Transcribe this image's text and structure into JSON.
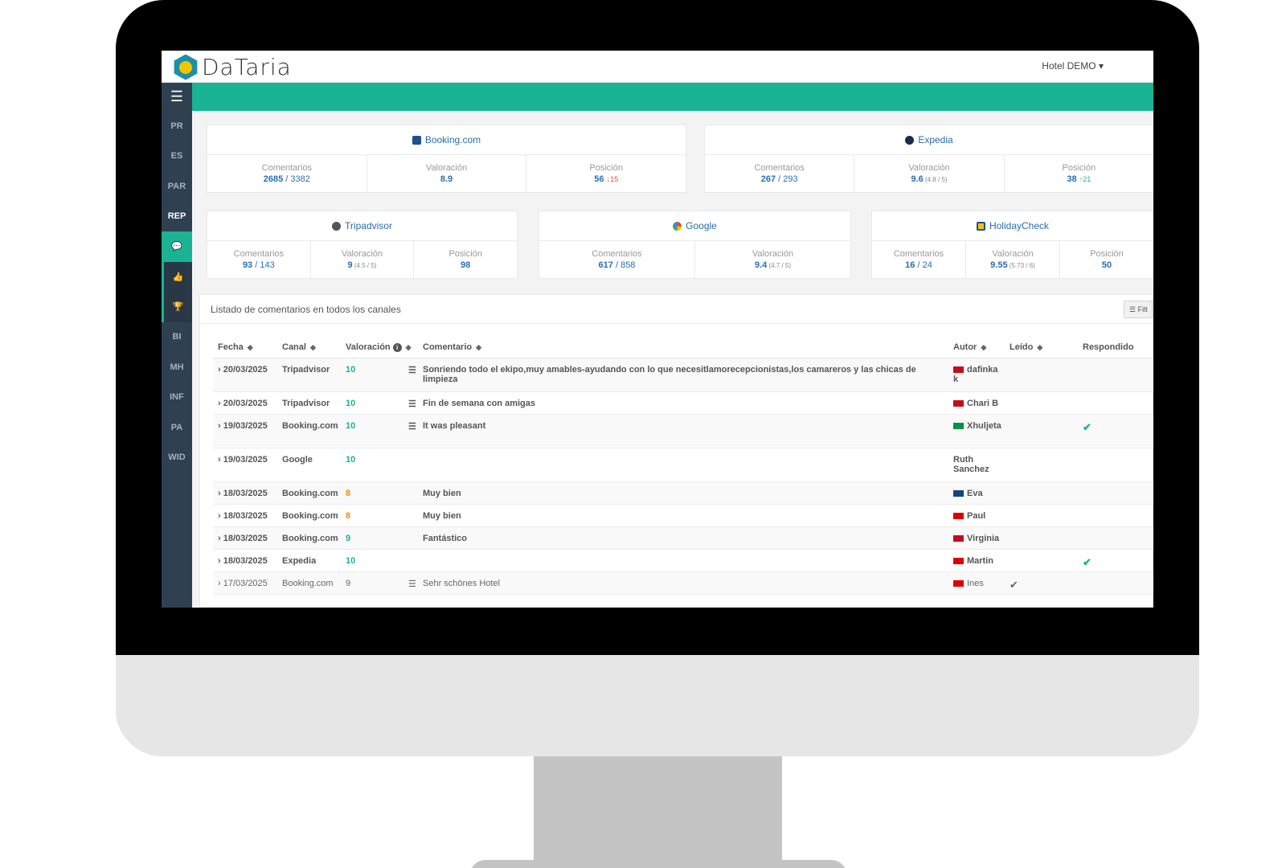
{
  "app": {
    "logo_text": "DaTaria",
    "hotel_menu": "Hotel DEMO ▾"
  },
  "sidebar": {
    "menu_icon": "☰",
    "items": [
      {
        "label": "PR"
      },
      {
        "label": "ES"
      },
      {
        "label": "PAR"
      },
      {
        "label": "REP"
      },
      {
        "label": "💬"
      },
      {
        "label": "👍"
      },
      {
        "label": "🏆"
      },
      {
        "label": "BI"
      },
      {
        "label": "MH"
      },
      {
        "label": "INF"
      },
      {
        "label": "PA"
      },
      {
        "label": "WID"
      }
    ]
  },
  "cards": {
    "booking": {
      "name": "Booking.com",
      "c_label": "Comentarios",
      "c_main": "2685",
      "c_total": " / 3382",
      "v_label": "Valoración",
      "v_main": "8.9",
      "p_label": "Posición",
      "p_main": "56",
      "p_delta": "↓15"
    },
    "expedia": {
      "name": "Expedia",
      "c_label": "Comentarios",
      "c_main": "267",
      "c_total": " / 293",
      "v_label": "Valoración",
      "v_main": "9.6",
      "v_sub": " (4.8 / 5)",
      "p_label": "Posición",
      "p_main": "38",
      "p_delta": "↑21"
    },
    "tripadvisor": {
      "name": "Tripadvisor",
      "c_label": "Comentarios",
      "c_main": "93",
      "c_total": " / 143",
      "v_label": "Valoración",
      "v_main": "9",
      "v_sub": " (4.5 / 5)",
      "p_label": "Posición",
      "p_main": "98"
    },
    "google": {
      "name": "Google",
      "c_label": "Comentarios",
      "c_main": "617",
      "c_total": " / 858",
      "v_label": "Valoración",
      "v_main": "9.4",
      "v_sub": " (4.7 / 5)"
    },
    "holidaycheck": {
      "name": "HolidayCheck",
      "c_label": "Comentarios",
      "c_main": "16",
      "c_total": " / 24",
      "v_label": "Valoración",
      "v_main": "9.55",
      "v_sub": " (5.73 / 6)",
      "p_label": "Posición",
      "p_main": "50"
    }
  },
  "list": {
    "title": "Listado de comentarios en todos los canales",
    "filter_label": "☰ Filt",
    "headers": {
      "fecha": "Fecha",
      "canal": "Canal",
      "valoracion": "Valoración",
      "comentario": "Comentario",
      "autor": "Autor",
      "leido": "Leído",
      "respondido": "Respondido"
    },
    "rows": [
      {
        "fecha": "20/03/2025",
        "canal": "Tripadvisor",
        "val": "10",
        "comment": "Sonriendo todo el ekipo,muy amables-ayudando con lo que necesitlamorecepcionistas,los camareros y las chicas de limpieza",
        "autor": "dafinka k",
        "leido": "",
        "resp": ""
      },
      {
        "fecha": "20/03/2025",
        "canal": "Tripadvisor",
        "val": "10",
        "comment": "Fin de semana con amigas",
        "autor": "Chari B",
        "leido": "",
        "resp": ""
      },
      {
        "fecha": "19/03/2025",
        "canal": "Booking.com",
        "val": "10",
        "comment": "It was pleasant",
        "autor": "Xhuljeta",
        "leido": "",
        "resp": "✔"
      },
      {
        "fecha": "19/03/2025",
        "canal": "Google",
        "val": "10",
        "comment": "",
        "autor": "Ruth Sanchez",
        "leido": "",
        "resp": ""
      },
      {
        "fecha": "18/03/2025",
        "canal": "Booking.com",
        "val": "8",
        "comment": "Muy bien",
        "autor": "Eva",
        "leido": "",
        "resp": ""
      },
      {
        "fecha": "18/03/2025",
        "canal": "Booking.com",
        "val": "8",
        "comment": "Muy bien",
        "autor": "Paul",
        "leido": "",
        "resp": ""
      },
      {
        "fecha": "18/03/2025",
        "canal": "Booking.com",
        "val": "9",
        "comment": "Fantástico",
        "autor": "Virginia",
        "leido": "",
        "resp": ""
      },
      {
        "fecha": "18/03/2025",
        "canal": "Expedia",
        "val": "10",
        "comment": "",
        "autor": "Martin",
        "leido": "",
        "resp": "✔"
      },
      {
        "fecha": "17/03/2025",
        "canal": "Booking.com",
        "val": "9",
        "comment": "Sehr schönes Hotel",
        "autor": "Ines",
        "leido": "✔",
        "resp": ""
      }
    ]
  },
  "colors": {
    "accent": "#1ab394",
    "sidebar": "#2f4050",
    "link": "#2a6db3",
    "rating_orange": "#f38a0b"
  }
}
